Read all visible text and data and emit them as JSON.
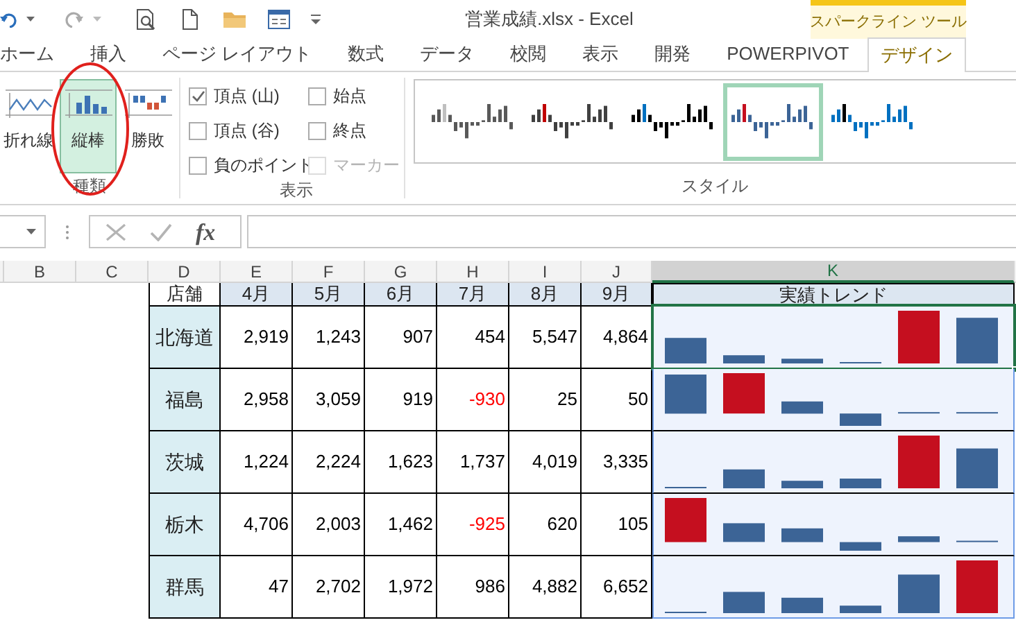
{
  "window": {
    "title": "営業成績.xlsx - Excel"
  },
  "context_tab": {
    "label": "スパークライン ツール"
  },
  "tabs": [
    {
      "label": "ホーム",
      "selected": false
    },
    {
      "label": "挿入",
      "selected": false
    },
    {
      "label": "ページ レイアウト",
      "selected": false
    },
    {
      "label": "数式",
      "selected": false
    },
    {
      "label": "データ",
      "selected": false
    },
    {
      "label": "校閲",
      "selected": false
    },
    {
      "label": "表示",
      "selected": false
    },
    {
      "label": "開発",
      "selected": false
    },
    {
      "label": "POWERPIVOT",
      "selected": false
    },
    {
      "label": "デザイン",
      "selected": true
    }
  ],
  "ribbon": {
    "type_group": {
      "label": "種類",
      "buttons": [
        {
          "label": "折れ線",
          "kind": "line",
          "selected": false
        },
        {
          "label": "縦棒",
          "kind": "column",
          "selected": true
        },
        {
          "label": "勝敗",
          "kind": "winloss",
          "selected": false
        }
      ]
    },
    "show_group": {
      "label": "表示",
      "checkboxes": [
        {
          "label": "頂点 (山)",
          "checked": true,
          "disabled": false
        },
        {
          "label": "始点",
          "checked": false,
          "disabled": false
        },
        {
          "label": "頂点 (谷)",
          "checked": false,
          "disabled": false
        },
        {
          "label": "終点",
          "checked": false,
          "disabled": false
        },
        {
          "label": "負のポイント",
          "checked": false,
          "disabled": false
        },
        {
          "label": "マーカー",
          "checked": false,
          "disabled": true
        }
      ]
    },
    "style_group": {
      "label": "スタイル",
      "styles": [
        {
          "color": "#595959",
          "accent": {
            "color": "#bfbfbf"
          },
          "selected": false
        },
        {
          "color": "#404040",
          "accent": {
            "color": "#c00000"
          },
          "selected": false
        },
        {
          "color": "#000000",
          "accent": {
            "color": "#0070c0"
          },
          "selected": false
        },
        {
          "color": "#3c6496",
          "accent": {
            "color": "#c50f1f"
          },
          "selected": true
        },
        {
          "color": "#0070c0",
          "accent": {
            "color": "#000000"
          },
          "selected": false
        }
      ]
    }
  },
  "formula_bar": {
    "function_button": "fx"
  },
  "column_headers": [
    {
      "label": "B",
      "selected": false
    },
    {
      "label": "C",
      "selected": false
    },
    {
      "label": "D",
      "selected": false
    },
    {
      "label": "E",
      "selected": false
    },
    {
      "label": "F",
      "selected": false
    },
    {
      "label": "G",
      "selected": false
    },
    {
      "label": "H",
      "selected": false
    },
    {
      "label": "I",
      "selected": false
    },
    {
      "label": "J",
      "selected": false
    },
    {
      "label": "K",
      "selected": true
    }
  ],
  "table": {
    "header": {
      "store_header": "店舗",
      "months": [
        "4月",
        "5月",
        "6月",
        "7月",
        "8月",
        "9月"
      ],
      "trend_header": "実績トレンド"
    },
    "rows": [
      {
        "store": "北海道",
        "selected": true,
        "cells": [
          {
            "text": "2,919",
            "negative": false
          },
          {
            "text": "1,243",
            "negative": false
          },
          {
            "text": "907",
            "negative": false
          },
          {
            "text": "454",
            "negative": false
          },
          {
            "text": "5,547",
            "negative": false
          },
          {
            "text": "4,864",
            "negative": false
          }
        ]
      },
      {
        "store": "福島",
        "selected": false,
        "cells": [
          {
            "text": "2,958",
            "negative": false
          },
          {
            "text": "3,059",
            "negative": false
          },
          {
            "text": "919",
            "negative": false
          },
          {
            "text": "-930",
            "negative": true
          },
          {
            "text": "25",
            "negative": false
          },
          {
            "text": "50",
            "negative": false
          }
        ]
      },
      {
        "store": "茨城",
        "selected": false,
        "cells": [
          {
            "text": "1,224",
            "negative": false
          },
          {
            "text": "2,224",
            "negative": false
          },
          {
            "text": "1,623",
            "negative": false
          },
          {
            "text": "1,737",
            "negative": false
          },
          {
            "text": "4,019",
            "negative": false
          },
          {
            "text": "3,335",
            "negative": false
          }
        ]
      },
      {
        "store": "栃木",
        "selected": false,
        "cells": [
          {
            "text": "4,706",
            "negative": false
          },
          {
            "text": "2,003",
            "negative": false
          },
          {
            "text": "1,462",
            "negative": false
          },
          {
            "text": "-925",
            "negative": true
          },
          {
            "text": "620",
            "negative": false
          },
          {
            "text": "105",
            "negative": false
          }
        ]
      },
      {
        "store": "群馬",
        "selected": false,
        "cells": [
          {
            "text": "47",
            "negative": false
          },
          {
            "text": "2,702",
            "negative": false
          },
          {
            "text": "1,972",
            "negative": false
          },
          {
            "text": "986",
            "negative": false
          },
          {
            "text": "4,882",
            "negative": false
          },
          {
            "text": "6,652",
            "negative": false
          }
        ]
      }
    ]
  }
}
